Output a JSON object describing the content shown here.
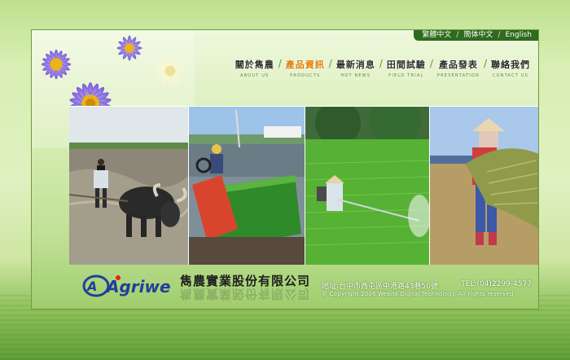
{
  "language_bar": {
    "items": [
      "繁體中文",
      "簡体中文",
      "English"
    ],
    "separator": "/"
  },
  "nav": {
    "separator": "/",
    "items": [
      {
        "label": "關於雋農",
        "sub": "ABOUT US"
      },
      {
        "label": "產品資訊",
        "sub": "PRODUCTS",
        "active": true
      },
      {
        "label": "最新消息",
        "sub": "HOT NEWS"
      },
      {
        "label": "田間試驗",
        "sub": "FIELD TRIAL"
      },
      {
        "label": "產品發表",
        "sub": "PRESENTATION"
      },
      {
        "label": "聯絡我們",
        "sub": "CONTACT US"
      }
    ]
  },
  "photos": [
    "water-buffalo-plowing",
    "rice-transplanter",
    "farmer-spraying-rice-field",
    "farmer-carrying-rice-bundle"
  ],
  "footer": {
    "logo_text": "Agriwell",
    "company": "雋農實業股份有限公司",
    "address": "地址:台中市西屯區中港路43巷50號",
    "tel": "TEL:(04)2299-4577",
    "copyright": "© Copyright 2006 Webits Digital Technology. All rights reserved"
  },
  "colors": {
    "accent_active": "#e07a00",
    "lang_bar_bg": "#2f6a1e",
    "logo_blue": "#1f3f9a",
    "logo_red": "#d9261c"
  }
}
